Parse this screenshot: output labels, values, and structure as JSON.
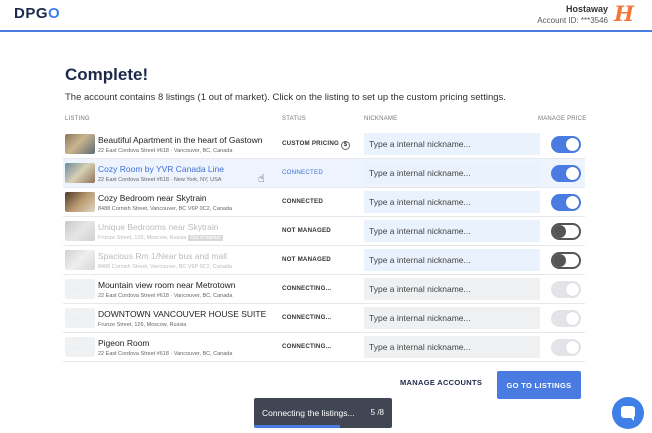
{
  "header": {
    "logo_main": "DPG",
    "logo_accent": "O",
    "account_name": "Hostaway",
    "account_id": "Account ID: ***3546",
    "partner_logo_letter": "H"
  },
  "page": {
    "title": "Complete!",
    "subtitle": "The account contains 8 listings (1 out of market). Click on the listing to set up the custom pricing settings."
  },
  "table": {
    "headers": {
      "listing": "LISTING",
      "status": "STATUS",
      "nickname": "NICKNAME",
      "manage_price": "MANAGE PRICE"
    },
    "rows": [
      {
        "name": "Beautiful Apartment in the heart of Gastown",
        "address": "22 East Cordova Street #618 · Vancouver, BC, Canada",
        "status": "CUSTOM PRICING",
        "nickname_placeholder": "Type a internal nickname...",
        "toggle": "on"
      },
      {
        "name": "Cozy Room by YVR Canada Line",
        "address": "22 East Cordova Street #618 · New York, NY, USA",
        "status": "CONNECTED",
        "nickname_placeholder": "Type a internal nickname...",
        "toggle": "on"
      },
      {
        "name": "Cozy Bedroom near Skytrain",
        "address": "8488 Cornish Street, Vancouver, BC V6P 0C2, Canada",
        "status": "CONNECTED",
        "nickname_placeholder": "Type a internal nickname...",
        "toggle": "on"
      },
      {
        "name": "Unique Bedrooms near Skytrain",
        "address": "Frunze Street, 126, Moscow, Russia",
        "badge": "Out of market",
        "status": "NOT MANAGED",
        "nickname_placeholder": "Type a internal nickname...",
        "toggle": "off"
      },
      {
        "name": "Spacious Rm 1/Near bus and mall",
        "address": "8488 Cornish Street, Vancouver, BC V6P 0C2, Canada",
        "status": "NOT MANAGED",
        "nickname_placeholder": "Type a internal nickname...",
        "toggle": "off"
      },
      {
        "name": "Mountain view room near Metrotown",
        "address": "22 East Cordova Street #618 · Vancouver, BC, Canada",
        "status": "CONNECTING...",
        "nickname_placeholder": "Type a internal nickname...",
        "toggle": "disabled"
      },
      {
        "name": "DOWNTOWN VANCOUVER HOUSE SUITE",
        "address": "Frunze Street, 126, Moscow, Russia",
        "status": "CONNECTING...",
        "nickname_placeholder": "Type a internal nickname...",
        "toggle": "disabled"
      },
      {
        "name": "Pigeon Room",
        "address": "22 East Cordova Street #618 · Vancouver, BC, Canada",
        "status": "CONNECTING...",
        "nickname_placeholder": "Type a internal nickname...",
        "toggle": "disabled"
      }
    ]
  },
  "actions": {
    "manage_accounts": "MANAGE ACCOUNTS",
    "go_to_listings": "GO TO LISTINGS"
  },
  "toast": {
    "message": "Connecting the listings...",
    "progress_text": "5 /8",
    "progress_fraction": 0.625
  },
  "colors": {
    "accent": "#4a7be0",
    "partner": "#f2773a",
    "title": "#1b2a4a"
  },
  "icons": {
    "chat": "chat-bubble-icon",
    "custom_pricing": "dollar-circle-icon",
    "cursor": "hand-pointer-icon"
  }
}
